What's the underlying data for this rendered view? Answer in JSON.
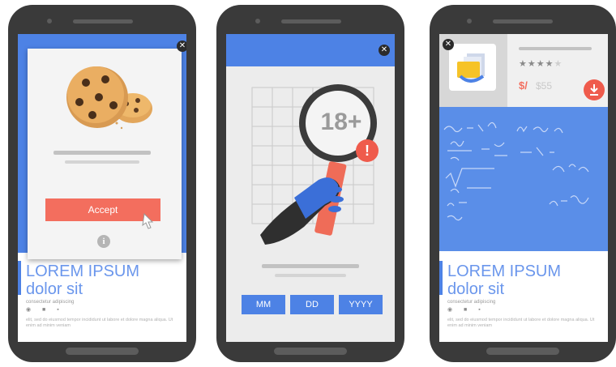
{
  "phone1": {
    "accept_label": "Accept",
    "close_glyph": "✕",
    "info_glyph": "i",
    "lorem_title_1": "LOREM IPSUM",
    "lorem_title_2": "dolor sit",
    "lorem_sub": "consectetur adipiscing",
    "lorem_body": "elit, sed do eiusmod tempor incididunt ut labore et dolore magna aliqua. Ut enim ad minim veniam"
  },
  "phone2": {
    "age_label": "18+",
    "close_glyph": "✕",
    "date_fields": [
      "MM",
      "DD",
      "YYYY"
    ]
  },
  "phone3": {
    "close_glyph": "✕",
    "stars": "★★★★",
    "stars_dim": "★",
    "price": "$/",
    "price_strike": "$55",
    "lorem_title_1": "LOREM IPSUM",
    "lorem_title_2": "dolor sit",
    "lorem_sub": "consectetur adipiscing",
    "lorem_body": "elit, sed do eiusmod tempor incididunt ut labore et dolore magna aliqua. Ut enim ad minim veniam"
  },
  "colors": {
    "brand_blue": "#4d82e5",
    "accent_red": "#f36e5e",
    "phone_body": "#3a3a3a"
  },
  "icons": [
    "cookie-illustration",
    "close-icon",
    "info-icon",
    "cursor-hand-icon",
    "magnifier-illustration",
    "warning-icon",
    "app-icon",
    "download-icon",
    "star-icon"
  ]
}
